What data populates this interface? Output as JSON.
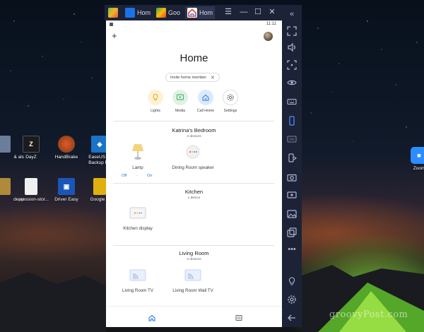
{
  "desktop": {
    "icons": [
      {
        "label": "& als",
        "color": "#6b7d99"
      },
      {
        "label": "DayZ",
        "color": "#1b1b1b"
      },
      {
        "label": "HandBrake",
        "color": "#3a2a15"
      },
      {
        "label": "EaseUS T Backup Fr",
        "color": "#1a73c8"
      },
      {
        "label": "ap",
        "color": "#b08a3a"
      },
      {
        "label": "depression-stor...",
        "color": "#f0f0f0"
      },
      {
        "label": "Driver Easy",
        "color": "#1a56b8"
      },
      {
        "label": "Google S",
        "color": "#e0b010"
      },
      {
        "label": "Zoom",
        "color": "#2d8cff"
      }
    ],
    "watermark": "groovyPost.com"
  },
  "emulator": {
    "tabs": [
      {
        "label": "",
        "color": "#7ac142"
      },
      {
        "label": "Hom",
        "color": "#1a73e8"
      },
      {
        "label": "Goo",
        "color": "#34a853"
      },
      {
        "label": "Hom",
        "color": "#ffffff"
      }
    ],
    "sidebar_icons": [
      "collapse-icon",
      "fullscreen-icon",
      "volume-icon",
      "expand-icon",
      "eye-icon",
      "keyboard-icon",
      "phone-icon",
      "apk-icon",
      "rotate-icon",
      "camera-icon",
      "record-icon",
      "gallery-icon",
      "multi-instance-icon",
      "more-icon",
      "light-icon",
      "settings-icon",
      "back-icon"
    ]
  },
  "android": {
    "status": {
      "time": "11:11"
    },
    "title": "Home",
    "invite_label": "Invite home member",
    "quick_actions": [
      {
        "label": "Lights",
        "icon": "bulb-icon",
        "bg": "#fdf1d6",
        "fg": "#e8a800"
      },
      {
        "label": "Media",
        "icon": "media-icon",
        "bg": "#dff2e3",
        "fg": "#34a853"
      },
      {
        "label": "Call Home",
        "icon": "call-home-icon",
        "bg": "#dce9fb",
        "fg": "#1a73e8"
      },
      {
        "label": "Settings",
        "icon": "settings-icon",
        "bg": "#ffffff",
        "fg": "#5f6368"
      }
    ],
    "rooms": [
      {
        "name": "Katrina's Bedroom",
        "count": "2 devices",
        "devices": [
          {
            "label": "Lamp"
          },
          {
            "label": "Dining Room speaker"
          }
        ],
        "lamp_off": "Off",
        "lamp_sep": "-",
        "lamp_on": "On"
      },
      {
        "name": "Kitchen",
        "count": "1 device",
        "devices": [
          {
            "label": "Kitchen display"
          }
        ]
      },
      {
        "name": "Living Room",
        "count": "2 devices",
        "devices": [
          {
            "label": "Living Room TV"
          },
          {
            "label": "Living Room Wall TV"
          }
        ]
      }
    ],
    "nav": [
      "home-icon",
      "feed-icon"
    ]
  }
}
